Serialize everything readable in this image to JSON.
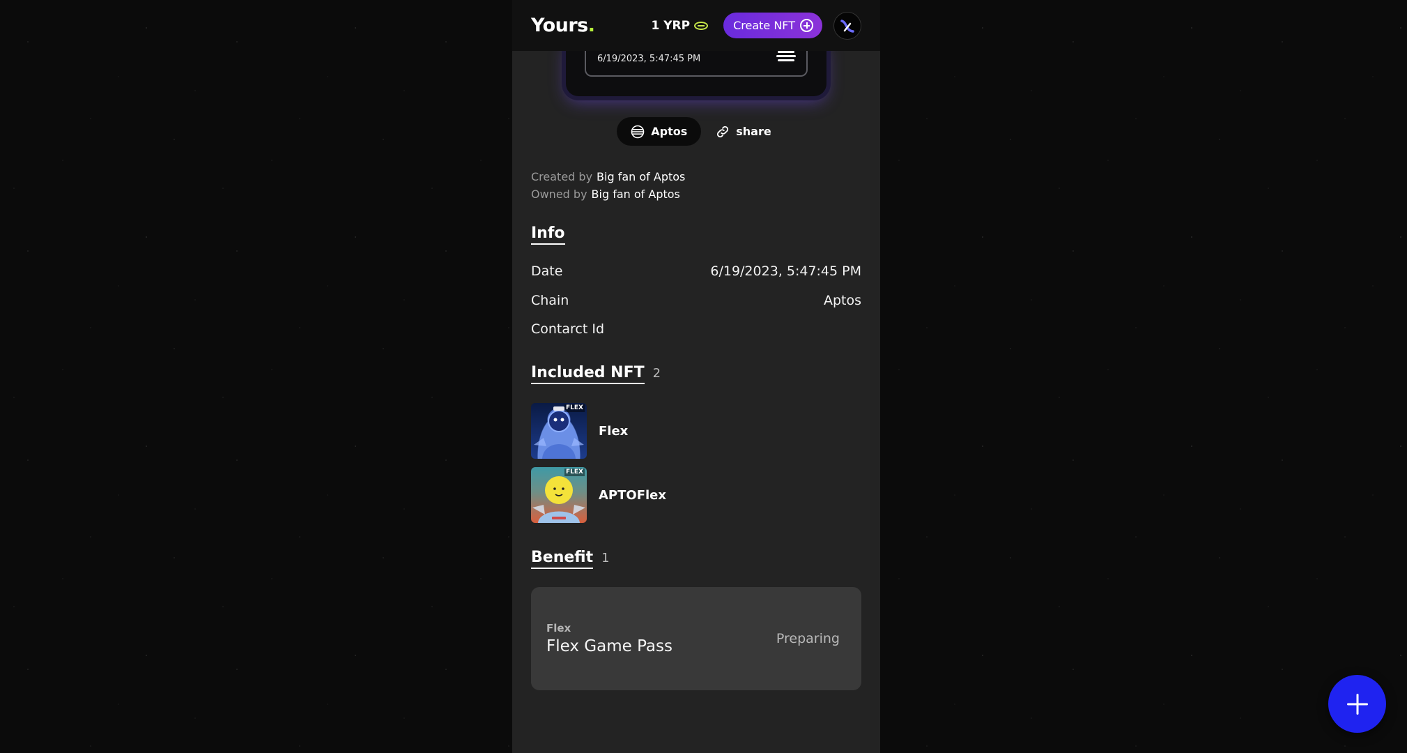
{
  "header": {
    "logo_text": "Yours",
    "logo_dot": ".",
    "balance": "1 YRP",
    "create_button_label": "Create NFT"
  },
  "card": {
    "date": "6/19/2023, 5:47:45 PM"
  },
  "actions": {
    "chain_label": "Aptos",
    "share_label": "share"
  },
  "credits": {
    "created_label": "Created by",
    "created_value": "Big fan of Aptos",
    "owned_label": "Owned by",
    "owned_value": "Big fan of Aptos"
  },
  "info": {
    "title": "Info",
    "rows": [
      {
        "label": "Date",
        "value": "6/19/2023, 5:47:45 PM"
      },
      {
        "label": "Chain",
        "value": "Aptos"
      },
      {
        "label": "Contarct Id",
        "value": ""
      }
    ]
  },
  "included_nft": {
    "title": "Included NFT",
    "count": "2",
    "items": [
      {
        "name": "Flex",
        "tag": "FLEX"
      },
      {
        "name": "APTOFlex",
        "tag": "FLEX"
      }
    ]
  },
  "benefit": {
    "title": "Benefit",
    "count": "1",
    "item": {
      "source": "Flex",
      "name": "Flex Game Pass",
      "status": "Preparing"
    }
  },
  "colors": {
    "accent_purple": "#7a2fdc",
    "fab_blue": "#1f23f0",
    "logo_dot": "#b6f23a"
  }
}
